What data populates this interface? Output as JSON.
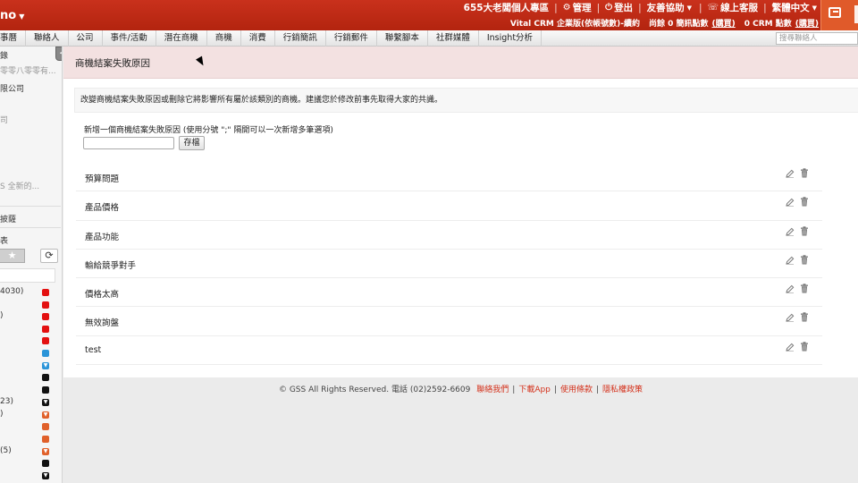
{
  "topbar": {
    "brand": "no",
    "org_name": "655大老闆個人專區",
    "manage": "管理",
    "logout": "登出",
    "help": "友善協助",
    "online_service": "線上客服",
    "language": "繁體中文",
    "plan_text": "Vital CRM 企業版(依帳號數)-續約",
    "sms_text": "尚餘 0 簡訊點數",
    "sms_buy": "(購買)",
    "crm_text": "0 CRM 點數",
    "crm_buy": "(購買)"
  },
  "nav": {
    "items": [
      "事曆",
      "聯絡人",
      "公司",
      "事件/活動",
      "潛在商機",
      "商機",
      "消費",
      "行銷簡訊",
      "行銷郵件",
      "聯繫腳本",
      "社群媒體",
      "Insight分析"
    ],
    "search_placeholder": "搜尋聯絡人"
  },
  "sidebar": {
    "tab_label": "<",
    "items": [
      "錄",
      "零零八零零有...",
      "限公司",
      "司",
      "S 全新的...",
      "披薩",
      "表"
    ],
    "list_items": [
      "4030)",
      ")",
      "23)",
      ")",
      "(5)"
    ]
  },
  "page": {
    "title": "商機結案失敗原因",
    "description": "改變商機結案失敗原因或刪除它將影響所有屬於該類別的商機。建議您於修改前事先取得大家的共識。",
    "add_label": "新增一個商機結案失敗原因 (使用分號 \";\" 隔開可以一次新增多筆選項)",
    "save_label": "存檔",
    "reasons": [
      "預算問題",
      "產品價格",
      "產品功能",
      "輸給競爭對手",
      "價格太高",
      "無效詢盤",
      "test"
    ]
  },
  "footer": {
    "copyright": "© GSS All Rights Reserved. 電話 (02)2592-6609",
    "contact": "聯絡我們",
    "download": "下載App",
    "terms": "使用條款",
    "privacy": "隱私權政策"
  },
  "colors": {
    "topbar": "#c0321c",
    "page_head": "#f3e1e1",
    "link": "#d4321c"
  }
}
